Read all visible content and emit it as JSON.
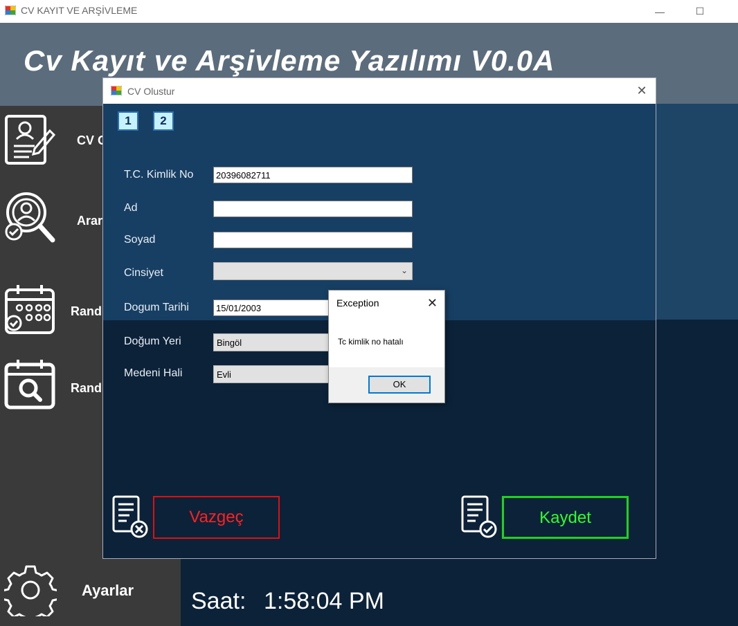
{
  "window": {
    "title": "CV KAYIT VE ARŞİVLEME",
    "minimize_glyph": "—",
    "maximize_glyph": "☐"
  },
  "header": {
    "heading": "Cv Kayıt ve Arşivleme Yazılımı V0.0A"
  },
  "sidebar": {
    "items": [
      {
        "label": "CV O",
        "icon": "cv-document-icon"
      },
      {
        "label": "Arar",
        "icon": "search-user-icon"
      },
      {
        "label": "Rand",
        "icon": "calendar-icon"
      },
      {
        "label": "Rand",
        "icon": "calendar-search-icon"
      }
    ],
    "settings_label": "Ayarlar",
    "settings_icon": "gear-icon"
  },
  "footer": {
    "clock_label": "Saat:",
    "clock_value": "1:58:04 PM"
  },
  "cv_dialog": {
    "title": "CV Olustur",
    "close_glyph": "✕",
    "pages": [
      "1",
      "2"
    ],
    "fields": {
      "tc_label": "T.C. Kimlik No",
      "tc_value": "20396082711",
      "ad_label": "Ad",
      "ad_value": "",
      "soyad_label": "Soyad",
      "soyad_value": "",
      "cinsiyet_label": "Cinsiyet",
      "cinsiyet_value": "",
      "dogum_tarihi_label": "Dogum Tarihi",
      "dogum_tarihi_value": "15/01/2003",
      "dogum_yeri_label": "Doğum Yeri",
      "dogum_yeri_value": "Bingöl",
      "medeni_hali_label": "Medeni Hali",
      "medeni_hali_value": "Evli"
    },
    "cancel_label": "Vazgeç",
    "save_label": "Kaydet"
  },
  "message_box": {
    "title": "Exception",
    "close_glyph": "✕",
    "message": "Tc kimlik no hatalı",
    "ok_label": "OK"
  },
  "colors": {
    "cancel": "#ff2020",
    "save": "#2cff2c",
    "dialog_upper": "#173f63",
    "dialog_lower": "#0b2238"
  }
}
